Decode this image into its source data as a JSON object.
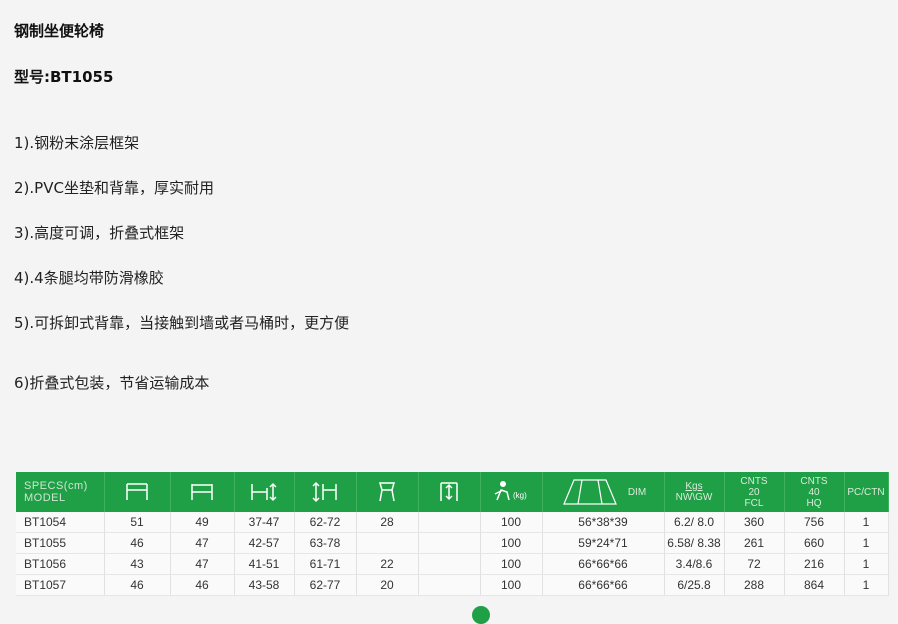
{
  "product": {
    "title": "钢制坐便轮椅",
    "model_label": "型号:BT1055"
  },
  "features": [
    "1).钢粉末涂层框架",
    "2).PVC坐垫和背靠，厚实耐用",
    "3).高度可调，折叠式框架",
    "4).4条腿均带防滑橡胶",
    "5).可拆卸式背靠，当接触到墙或者马桶时，更方便",
    "6)折叠式包装，节省运输成本"
  ],
  "table": {
    "corner_top": "SPECS(cm)",
    "corner_bottom": "MODEL",
    "header_icons": [
      "chair-width-icon",
      "seat-width-icon",
      "seat-height-icon",
      "overall-height-icon",
      "seat-depth-icon",
      "depth-icon",
      "weight-capacity-icon"
    ],
    "weight_capacity_unit": "(kg)",
    "dim_label": "DIM",
    "nw_top": "Kgs",
    "nw_bottom": "NW\\GW",
    "fcl": [
      "CNTS",
      "20",
      "FCL"
    ],
    "hq": [
      "CNTS",
      "40",
      "HQ"
    ],
    "pc_ctn": "PC/CTN",
    "rows": [
      [
        "BT1054",
        "51",
        "49",
        "37-47",
        "62-72",
        "28",
        "",
        "100",
        "56*38*39",
        "6.2/ 8.0",
        "360",
        "756",
        "1"
      ],
      [
        "BT1055",
        "46",
        "47",
        "42-57",
        "63-78",
        "",
        "",
        "100",
        "59*24*71",
        "6.58/ 8.38",
        "261",
        "660",
        "1"
      ],
      [
        "BT1056",
        "43",
        "47",
        "41-51",
        "61-71",
        "22",
        "",
        "100",
        "66*66*66",
        "3.4/8.6",
        "72",
        "216",
        "1"
      ],
      [
        "BT1057",
        "46",
        "46",
        "43-58",
        "62-77",
        "20",
        "",
        "100",
        "66*66*66",
        "6/25.8",
        "288",
        "864",
        "1"
      ]
    ]
  },
  "colors": {
    "header_green": "#1fa046"
  }
}
